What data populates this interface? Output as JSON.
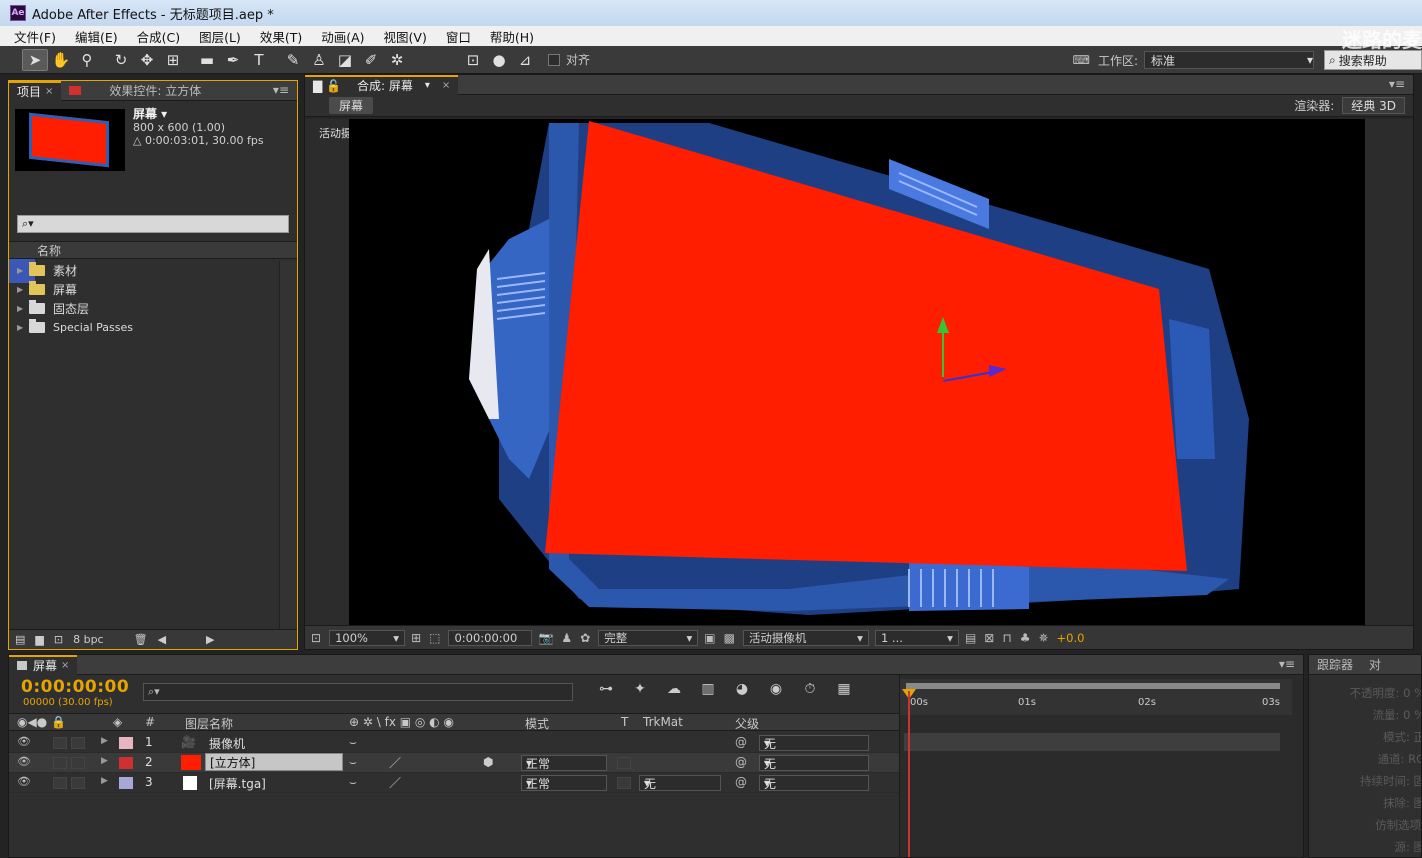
{
  "app": {
    "title": "Adobe After Effects - 无标题项目.aep *",
    "logo_text": "Ae"
  },
  "menu": [
    "文件(F)",
    "编辑(E)",
    "合成(C)",
    "图层(L)",
    "效果(T)",
    "动画(A)",
    "视图(V)",
    "窗口",
    "帮助(H)"
  ],
  "toolbar": {
    "tools": [
      "selection-tool",
      "hand-tool",
      "zoom-tool",
      "rotate-tool",
      "orbit-camera-tool",
      "pan-behind-tool",
      "rectangle-tool",
      "pen-tool",
      "type-tool",
      "brush-tool",
      "clone-stamp-tool",
      "eraser-tool",
      "roto-brush-tool",
      "puppet-tool"
    ],
    "align_label": "对齐",
    "workspace_label": "工作区:",
    "workspace_value": "标准",
    "search_help": "搜索帮助",
    "watermark": "迷路的麦"
  },
  "project": {
    "tab_project": "项目",
    "tab_effects": "效果控件: 立方体",
    "comp_name": "屏幕 ▾",
    "comp_size": "800 x 600 (1.00)",
    "comp_duration": "△ 0:00:03:01, 30.00 fps",
    "search_placeholder": "⌕▾",
    "column_name": "名称",
    "items": [
      {
        "name": "素材",
        "color": "yellow"
      },
      {
        "name": "屏幕",
        "color": "yellow"
      },
      {
        "name": "固态层",
        "color": "gray"
      },
      {
        "name": "Special Passes",
        "color": "gray"
      }
    ],
    "bpc": "8 bpc"
  },
  "viewer": {
    "tab_label": "合成: 屏幕",
    "sub_tab": "屏幕",
    "renderer_label": "渲染器:",
    "renderer_value": "经典 3D",
    "active_camera": "活动摄像机",
    "zoom": "100%",
    "timecode": "0:00:00:00",
    "resolution": "完整",
    "view": "活动摄像机",
    "views_count": "1 ...",
    "exposure": "+0.0"
  },
  "timeline": {
    "tab_label": "屏幕",
    "timecode": "0:00:00:00",
    "fps": "00000 (30.00 fps)",
    "search_placeholder": "⌕▾",
    "headers": {
      "num": "#",
      "layer_name": "图层名称",
      "switches": "⊕ ✲ \\ fx ▣ ◎ ◐ ◉",
      "mode": "模式",
      "t": "T",
      "trkmat": "TrkMat",
      "parent": "父级"
    },
    "layers": [
      {
        "num": "1",
        "name": "摄像机",
        "label_color": "#e8b4c0",
        "icon": "camera-icon",
        "mode": "",
        "trkmat": "",
        "parent": "无",
        "selected": false
      },
      {
        "num": "2",
        "name": "[立方体]",
        "label_color": "#d03030",
        "icon": "solid-icon",
        "mode": "正常",
        "trkmat": "",
        "parent": "无",
        "selected": true
      },
      {
        "num": "3",
        "name": "[屏幕.tga]",
        "label_color": "#a8a8d8",
        "icon": "footage-icon",
        "mode": "正常",
        "trkmat": "无",
        "parent": "无",
        "selected": false
      }
    ],
    "ruler": [
      "00s",
      "01s",
      "02s",
      "03s"
    ]
  },
  "tracker": {
    "tab_label": "跟踪器",
    "tab2": "对",
    "rows": [
      "不透明度: 0 %",
      "流量: 0 %",
      "模式: 正",
      "通道: RG",
      "持续时间: 固",
      "抹除: 图",
      "仿制选项: ",
      "源: 图"
    ]
  },
  "colors": {
    "accent": "#e6a400",
    "screen_red": "#ff1e00",
    "frame_blue": "#2d5fb5"
  }
}
